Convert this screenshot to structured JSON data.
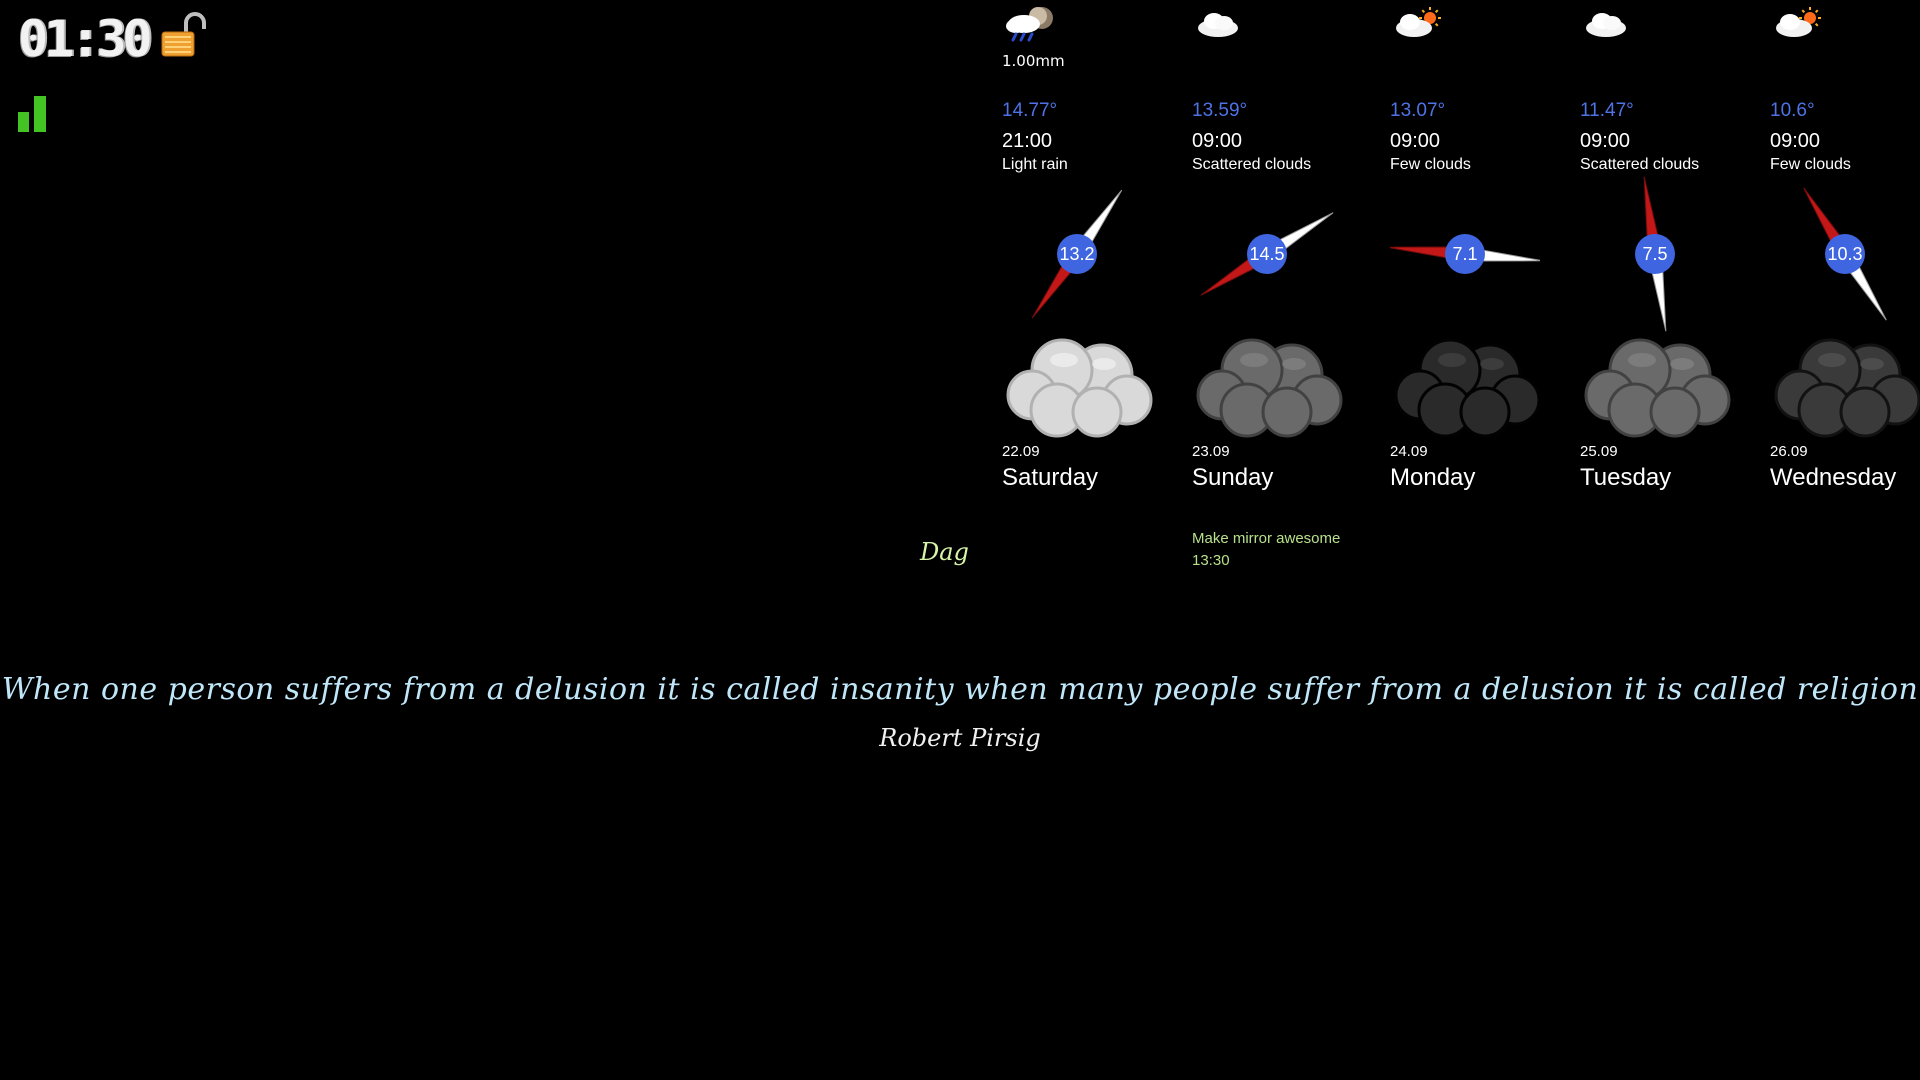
{
  "clock": {
    "time": "01:30"
  },
  "status": {
    "lock_icon": "padlock-open-icon",
    "signal_icon": "signal-bars-icon",
    "signal_color": "#44c424"
  },
  "forecast": [
    {
      "precip": "1.00mm",
      "temp": "14.77°",
      "time": "21:00",
      "description": "Light rain",
      "wind_speed": "13.2",
      "wind_dir_deg": 35,
      "date": "22.09",
      "day": "Saturday",
      "icon": "rain-night-icon",
      "cloud_icon": "cloud-light-icon",
      "cloud_color": "#d9d9d9"
    },
    {
      "precip": "",
      "temp": "13.59°",
      "time": "09:00",
      "description": "Scattered clouds",
      "wind_speed": "14.5",
      "wind_dir_deg": 58,
      "date": "23.09",
      "day": "Sunday",
      "icon": "cloud-icon",
      "cloud_icon": "cloud-gray-icon",
      "cloud_color": "#6a6a6a"
    },
    {
      "precip": "",
      "temp": "13.07°",
      "time": "09:00",
      "description": "Few clouds",
      "wind_speed": "7.1",
      "wind_dir_deg": 95,
      "date": "24.09",
      "day": "Monday",
      "icon": "partly-sunny-icon",
      "cloud_icon": "cloud-dark-icon",
      "cloud_color": "#2a2a2a"
    },
    {
      "precip": "",
      "temp": "11.47°",
      "time": "09:00",
      "description": "Scattered clouds",
      "wind_speed": "7.5",
      "wind_dir_deg": 172,
      "date": "25.09",
      "day": "Tuesday",
      "icon": "cloud-icon",
      "cloud_icon": "cloud-gray-icon",
      "cloud_color": "#6a6a6a"
    },
    {
      "precip": "",
      "temp": "10.6°",
      "time": "09:00",
      "description": "Few clouds",
      "wind_speed": "10.3",
      "wind_dir_deg": 148,
      "date": "26.09",
      "day": "Wednesday",
      "icon": "partly-sunny-icon",
      "cloud_icon": "cloud-dark-icon",
      "cloud_color": "#3a3a3a"
    }
  ],
  "calendar": {
    "label": "Dag",
    "events": [
      {
        "title": "Make mirror awesome",
        "time": "13:30"
      }
    ]
  },
  "quote": {
    "text": "When one person suffers from a delusion it is called insanity  when many people suffer from a delusion it is called religion",
    "author": "Robert Pirsig"
  },
  "colors": {
    "temp": "#4f73e6",
    "wind_badge": "#3f66e0",
    "quote": "#bfe7f9",
    "agenda": "#b7e08a"
  }
}
